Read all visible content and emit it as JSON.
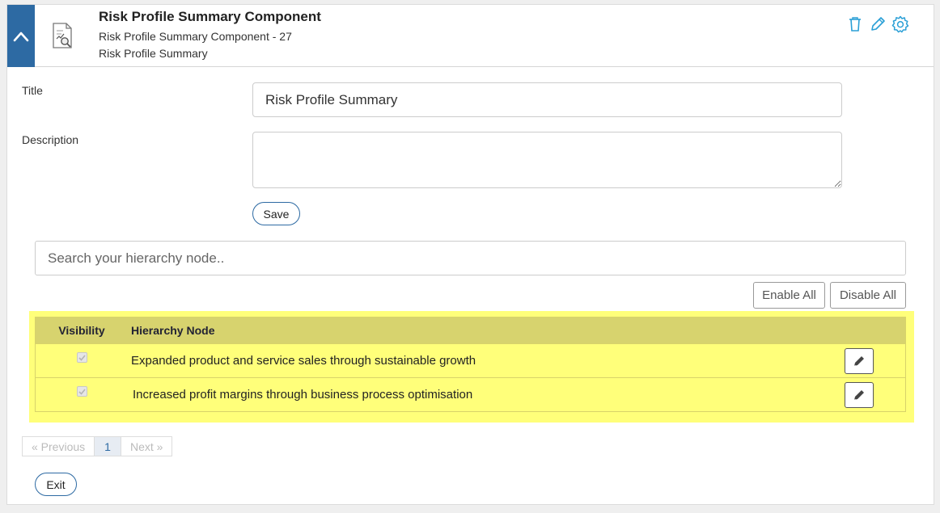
{
  "header": {
    "title": "Risk Profile Summary Component",
    "subtitle": "Risk Profile Summary Component - 27",
    "subtitle2": "Risk Profile Summary",
    "icons": [
      "chevron-up-icon",
      "report-search-icon",
      "trash-icon",
      "pencil-icon",
      "gear-icon"
    ]
  },
  "form": {
    "title_label": "Title",
    "title_value": "Risk Profile Summary",
    "description_label": "Description",
    "description_value": "",
    "save_label": "Save"
  },
  "search": {
    "placeholder": "Search your hierarchy node.."
  },
  "actions": {
    "enable_all": "Enable All",
    "disable_all": "Disable All"
  },
  "table": {
    "headers": [
      "Visibility",
      "Hierarchy Node"
    ],
    "rows": [
      {
        "checked": true,
        "node": "Expanded product and service sales through sustainable growth"
      },
      {
        "checked": true,
        "node": "Increased profit margins through business process optimisation"
      }
    ]
  },
  "pagination": {
    "previous": "«  Previous",
    "page": "1",
    "next": "Next  »"
  },
  "exit_label": "Exit",
  "colors": {
    "accent": "#2d6aa3",
    "highlight": "#ffff7a",
    "table_header": "#d7d36e"
  }
}
